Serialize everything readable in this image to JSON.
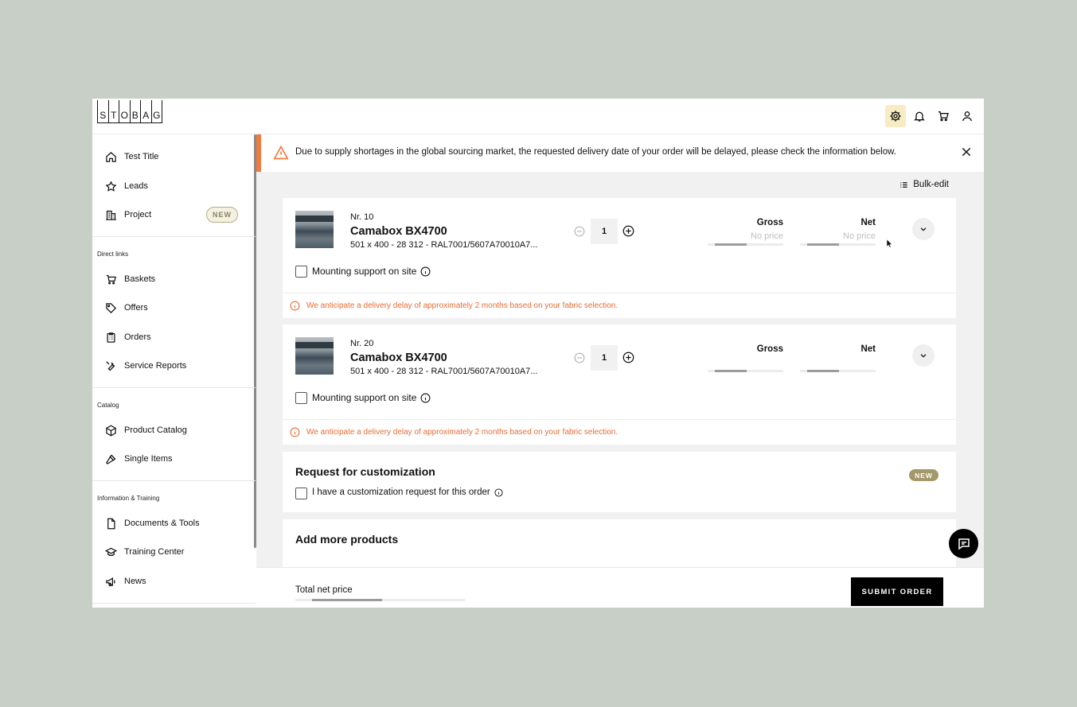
{
  "brand": {
    "logo_letters": [
      "S",
      "T",
      "O",
      "B",
      "A",
      "G"
    ]
  },
  "topbar": {
    "icons": [
      "gear-icon",
      "bell-icon",
      "cart-icon",
      "user-icon"
    ],
    "active_icon": "gear-icon",
    "active_color": "#f7ecc3"
  },
  "sidebar": {
    "items_top": [
      {
        "label": "Test Title",
        "icon": "home-icon"
      },
      {
        "label": "Leads",
        "icon": "star-icon"
      },
      {
        "label": "Project",
        "icon": "building-icon",
        "badge": "NEW"
      }
    ],
    "direct_links_heading": "Direct links",
    "direct_links": [
      {
        "label": "Baskets",
        "icon": "cart-icon"
      },
      {
        "label": "Offers",
        "icon": "tag-icon"
      },
      {
        "label": "Orders",
        "icon": "clipboard-icon"
      },
      {
        "label": "Service Reports",
        "icon": "wrench-icon"
      }
    ],
    "catalog_heading": "Catalog",
    "catalog": [
      {
        "label": "Product Catalog",
        "icon": "box-icon"
      },
      {
        "label": "Single Items",
        "icon": "hammer-icon"
      }
    ],
    "info_heading": "Information & Training",
    "info": [
      {
        "label": "Documents & Tools",
        "icon": "document-icon"
      },
      {
        "label": "Training Center",
        "icon": "graduation-cap-icon"
      },
      {
        "label": "News",
        "icon": "megaphone-icon"
      }
    ]
  },
  "alert": {
    "text": "Due to supply shortages in the global sourcing market, the requested delivery date of your order will be delayed, please check the information below.",
    "accent": "#ef7b3f"
  },
  "bulk_edit_label": "Bulk-edit",
  "line_items": [
    {
      "nr": "Nr. 10",
      "name": "Camabox BX4700",
      "desc": "501 x 400 - 28 312 - RAL7001/5607A70010A7...",
      "qty": "1",
      "gross_label": "Gross",
      "net_label": "Net",
      "gross_value": "No price",
      "net_value": "No price",
      "mounting_label": "Mounting support on site",
      "delay_text": "We anticipate a delivery delay of approximately 2 months based on your fabric selection."
    },
    {
      "nr": "Nr. 20",
      "name": "Camabox BX4700",
      "desc": "501 x 400 - 28 312 - RAL7001/5607A70010A7...",
      "qty": "1",
      "gross_label": "Gross",
      "net_label": "Net",
      "mounting_label": "Mounting support on site",
      "delay_text": "We anticipate a delivery delay of approximately 2 months based on your fabric selection."
    }
  ],
  "customization": {
    "title": "Request for customization",
    "badge": "NEW",
    "checkbox_label": "I have a customization request for this order"
  },
  "add_more": {
    "title": "Add more products"
  },
  "footer": {
    "total_label": "Total net price",
    "submit_label": "SUBMIT ORDER"
  },
  "colors": {
    "delay_text": "#e86c34",
    "badge_gold": "#a3986a",
    "background": "#c8cfc6"
  }
}
